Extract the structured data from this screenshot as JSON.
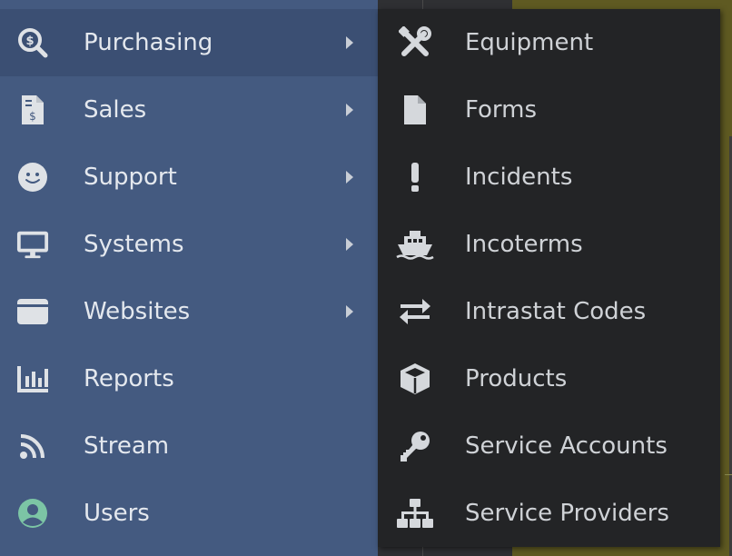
{
  "sidebar": {
    "items": [
      {
        "label": "Purchasing",
        "icon": "search-dollar-icon",
        "has_submenu": true,
        "active": true
      },
      {
        "label": "Sales",
        "icon": "invoice-dollar-icon",
        "has_submenu": true
      },
      {
        "label": "Support",
        "icon": "smile-icon",
        "has_submenu": true
      },
      {
        "label": "Systems",
        "icon": "desktop-icon",
        "has_submenu": true
      },
      {
        "label": "Websites",
        "icon": "window-icon",
        "has_submenu": true
      },
      {
        "label": "Reports",
        "icon": "bar-chart-icon",
        "has_submenu": false
      },
      {
        "label": "Stream",
        "icon": "rss-icon",
        "has_submenu": false
      },
      {
        "label": "Users",
        "icon": "user-circle-icon",
        "has_submenu": false
      }
    ]
  },
  "submenu": {
    "items": [
      {
        "label": "Equipment",
        "icon": "tools-icon"
      },
      {
        "label": "Forms",
        "icon": "file-icon"
      },
      {
        "label": "Incidents",
        "icon": "exclamation-icon"
      },
      {
        "label": "Incoterms",
        "icon": "ship-icon"
      },
      {
        "label": "Intrastat Codes",
        "icon": "exchange-icon"
      },
      {
        "label": "Products",
        "icon": "box-icon"
      },
      {
        "label": "Service Accounts",
        "icon": "key-icon"
      },
      {
        "label": "Service Providers",
        "icon": "sitemap-icon"
      }
    ]
  },
  "colors": {
    "sidebar_bg": "#445a80",
    "sidebar_active_bg": "#3b4f73",
    "submenu_bg": "#232426",
    "icon_color": "#d5d8dc",
    "users_icon_accent": "#7cc5a5"
  }
}
